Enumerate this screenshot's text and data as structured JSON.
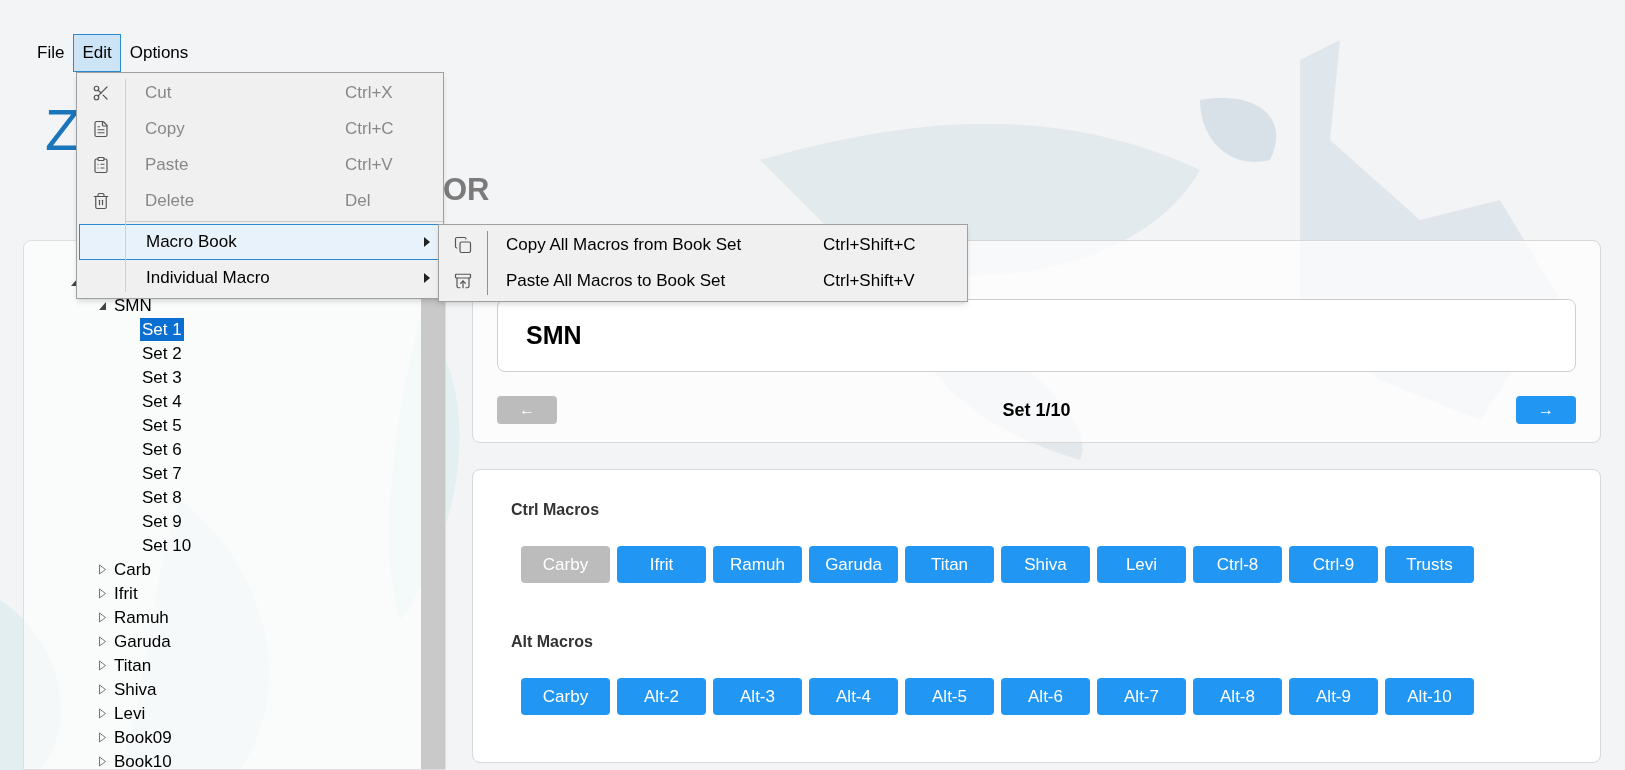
{
  "menu_bar": [
    {
      "label": "File",
      "selected": false
    },
    {
      "label": "Edit",
      "selected": true
    },
    {
      "label": "Options",
      "selected": false
    }
  ],
  "header": {
    "title": "Z",
    "subtitle": "OR"
  },
  "edit_menu": {
    "items": [
      {
        "kind": "command",
        "label": "Cut",
        "shortcut": "Ctrl+X",
        "disabled": true
      },
      {
        "kind": "command",
        "label": "Copy",
        "shortcut": "Ctrl+C",
        "disabled": true
      },
      {
        "kind": "command",
        "label": "Paste",
        "shortcut": "Ctrl+V",
        "disabled": true
      },
      {
        "kind": "command",
        "label": "Delete",
        "shortcut": "Del",
        "disabled": true
      },
      {
        "kind": "separator"
      },
      {
        "kind": "submenu",
        "label": "Macro Book",
        "selected": true
      },
      {
        "kind": "submenu",
        "label": "Individual Macro",
        "selected": false
      }
    ]
  },
  "submenu": {
    "items": [
      {
        "label": "Copy All Macros from Book Set",
        "shortcut": "Ctrl+Shift+C"
      },
      {
        "label": "Paste All Macros to Book Set",
        "shortcut": "Ctrl+Shift+V"
      }
    ]
  },
  "tree": {
    "expanded": true,
    "children": [
      {
        "label": "SMN",
        "expanded": true,
        "children": [
          {
            "label": "Set 1",
            "selected": true
          },
          {
            "label": "Set 2",
            "selected": false
          },
          {
            "label": "Set 3",
            "selected": false
          },
          {
            "label": "Set 4",
            "selected": false
          },
          {
            "label": "Set 5",
            "selected": false
          },
          {
            "label": "Set 6",
            "selected": false
          },
          {
            "label": "Set 7",
            "selected": false
          },
          {
            "label": "Set 8",
            "selected": false
          },
          {
            "label": "Set 9",
            "selected": false
          },
          {
            "label": "Set 10",
            "selected": false
          }
        ]
      },
      {
        "label": "Carb",
        "expanded": false
      },
      {
        "label": "Ifrit",
        "expanded": false
      },
      {
        "label": "Ramuh",
        "expanded": false
      },
      {
        "label": "Garuda",
        "expanded": false
      },
      {
        "label": "Titan",
        "expanded": false
      },
      {
        "label": "Shiva",
        "expanded": false
      },
      {
        "label": "Levi",
        "expanded": false
      },
      {
        "label": "Book09",
        "expanded": false
      },
      {
        "label": "Book10",
        "expanded": false
      }
    ]
  },
  "book": {
    "name": "SMN",
    "set_label": "Set 1/10",
    "prev": {
      "label": "←",
      "disabled": true
    },
    "next": {
      "label": "→",
      "disabled": false
    }
  },
  "macro_groups": [
    {
      "title": "Ctrl Macros",
      "buttons": [
        {
          "label": "Carby",
          "disabled": true
        },
        {
          "label": "Ifrit",
          "disabled": false
        },
        {
          "label": "Ramuh",
          "disabled": false
        },
        {
          "label": "Garuda",
          "disabled": false
        },
        {
          "label": "Titan",
          "disabled": false
        },
        {
          "label": "Shiva",
          "disabled": false
        },
        {
          "label": "Levi",
          "disabled": false
        },
        {
          "label": "Ctrl-8",
          "disabled": false
        },
        {
          "label": "Ctrl-9",
          "disabled": false
        },
        {
          "label": "Trusts",
          "disabled": false
        }
      ]
    },
    {
      "title": "Alt Macros",
      "buttons": [
        {
          "label": "Carby",
          "disabled": false
        },
        {
          "label": "Alt-2",
          "disabled": false
        },
        {
          "label": "Alt-3",
          "disabled": false
        },
        {
          "label": "Alt-4",
          "disabled": false
        },
        {
          "label": "Alt-5",
          "disabled": false
        },
        {
          "label": "Alt-6",
          "disabled": false
        },
        {
          "label": "Alt-7",
          "disabled": false
        },
        {
          "label": "Alt-8",
          "disabled": false
        },
        {
          "label": "Alt-9",
          "disabled": false
        },
        {
          "label": "Alt-10",
          "disabled": false
        }
      ]
    }
  ]
}
